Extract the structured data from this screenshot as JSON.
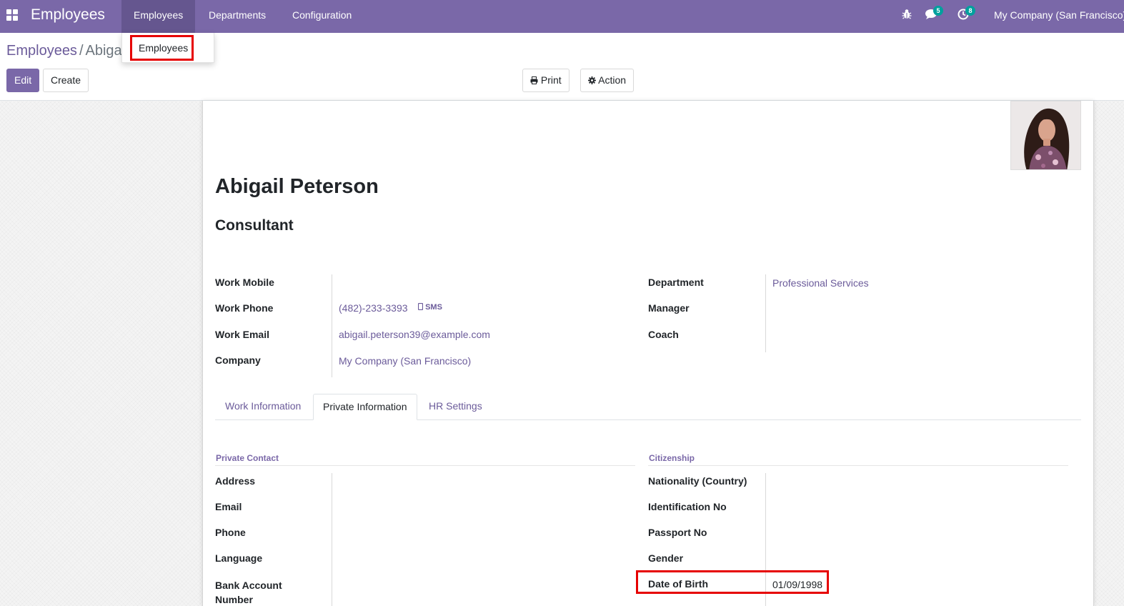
{
  "navbar": {
    "brand": "Employees",
    "menu": [
      {
        "label": "Employees",
        "active": true
      },
      {
        "label": "Departments"
      },
      {
        "label": "Configuration"
      }
    ],
    "icons": [
      "bug-icon",
      "chat-icon",
      "clock-icon"
    ],
    "messages_count": "5",
    "activities_count": "8",
    "company": "My Company (San Francisco)"
  },
  "dropdown": {
    "items": [
      "Employees"
    ]
  },
  "breadcrumb": {
    "root": "Employees",
    "separator": "/",
    "current": "Abigail Peterson"
  },
  "buttons": {
    "edit": "Edit",
    "create": "Create",
    "print": "Print",
    "action": "Action",
    "sms": "SMS"
  },
  "employee": {
    "name": "Abigail Peterson",
    "job_title": "Consultant",
    "fields_left": [
      {
        "label": "Work Mobile",
        "value": ""
      },
      {
        "label": "Work Phone",
        "value": "(482)-233-3393"
      },
      {
        "label": "Work Email",
        "value": "abigail.peterson39@example.com"
      },
      {
        "label": "Company",
        "value": "My Company (San Francisco)"
      }
    ],
    "fields_right": [
      {
        "label": "Department",
        "value": "Professional Services"
      },
      {
        "label": "Manager",
        "value": ""
      },
      {
        "label": "Coach",
        "value": ""
      }
    ]
  },
  "tabs": [
    {
      "label": "Work Information"
    },
    {
      "label": "Private Information",
      "active": true
    },
    {
      "label": "HR Settings"
    }
  ],
  "private_contact": {
    "title": "Private Contact",
    "fields": [
      {
        "label": "Address",
        "value": ""
      },
      {
        "label": "Email",
        "value": ""
      },
      {
        "label": "Phone",
        "value": ""
      },
      {
        "label": "Language",
        "value": ""
      },
      {
        "label": "Bank Account Number",
        "value": ""
      }
    ]
  },
  "citizenship": {
    "title": "Citizenship",
    "fields": [
      {
        "label": "Nationality (Country)",
        "value": ""
      },
      {
        "label": "Identification No",
        "value": ""
      },
      {
        "label": "Passport No",
        "value": ""
      },
      {
        "label": "Gender",
        "value": ""
      },
      {
        "label": "Date of Birth",
        "value": "01/09/1998"
      }
    ]
  },
  "colors": {
    "navbar": "#7a68a8",
    "link": "#6b5b9a",
    "highlight": "#e60000",
    "badge": "#00a09d"
  }
}
